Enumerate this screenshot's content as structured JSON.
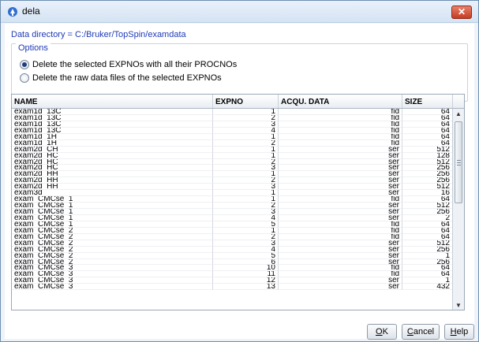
{
  "window": {
    "title": "dela",
    "close_glyph": "✕",
    "app_icon": "topspin-app-icon"
  },
  "data_directory": "Data directory = C:/Bruker/TopSpin/examdata",
  "options": {
    "legend": "Options",
    "items": [
      {
        "label": "Delete the selected EXPNOs with all their PROCNOs",
        "selected": true
      },
      {
        "label": "Delete the raw data files of the selected EXPNOs",
        "selected": false
      }
    ]
  },
  "table": {
    "columns": [
      "NAME",
      "EXPNO",
      "ACQU. DATA",
      "SIZE"
    ],
    "rows": [
      [
        "exam1d_13C",
        "1",
        "fid",
        "64"
      ],
      [
        "exam1d_13C",
        "2",
        "fid",
        "64"
      ],
      [
        "exam1d_13C",
        "3",
        "fid",
        "64"
      ],
      [
        "exam1d_13C",
        "4",
        "fid",
        "64"
      ],
      [
        "exam1d_1H",
        "1",
        "fid",
        "64"
      ],
      [
        "exam1d_1H",
        "2",
        "fid",
        "64"
      ],
      [
        "exam2d_CH",
        "1",
        "ser",
        "512"
      ],
      [
        "exam2d_HC",
        "1",
        "ser",
        "128"
      ],
      [
        "exam2d_HC",
        "2",
        "ser",
        "512"
      ],
      [
        "exam2d_HC",
        "3",
        "ser",
        "256"
      ],
      [
        "exam2d_HH",
        "1",
        "ser",
        "256"
      ],
      [
        "exam2d_HH",
        "2",
        "ser",
        "256"
      ],
      [
        "exam2d_HH",
        "3",
        "ser",
        "512"
      ],
      [
        "exam3d",
        "1",
        "ser",
        "16"
      ],
      [
        "exam_CMCse_1",
        "1",
        "fid",
        "64"
      ],
      [
        "exam_CMCse_1",
        "2",
        "ser",
        "512"
      ],
      [
        "exam_CMCse_1",
        "3",
        "ser",
        "256"
      ],
      [
        "exam_CMCse_1",
        "4",
        "ser",
        "2"
      ],
      [
        "exam_CMCse_1",
        "5",
        "fid",
        "64"
      ],
      [
        "exam_CMCse_2",
        "1",
        "fid",
        "64"
      ],
      [
        "exam_CMCse_2",
        "2",
        "fid",
        "64"
      ],
      [
        "exam_CMCse_2",
        "3",
        "ser",
        "512"
      ],
      [
        "exam_CMCse_2",
        "4",
        "ser",
        "256"
      ],
      [
        "exam_CMCse_2",
        "5",
        "ser",
        "1"
      ],
      [
        "exam_CMCse_2",
        "6",
        "ser",
        "256"
      ],
      [
        "exam_CMCse_3",
        "10",
        "fid",
        "64"
      ],
      [
        "exam_CMCse_3",
        "11",
        "fid",
        "64"
      ],
      [
        "exam_CMCse_3",
        "12",
        "ser",
        "1"
      ],
      [
        "exam_CMCse_3",
        "13",
        "ser",
        "432"
      ]
    ]
  },
  "scrollbar": {
    "up_glyph": "▲",
    "down_glyph": "▼"
  },
  "buttons": {
    "ok": {
      "mnemonic": "O",
      "rest": "K"
    },
    "cancel": {
      "mnemonic": "C",
      "rest": "ancel"
    },
    "help": {
      "mnemonic": "H",
      "rest": "elp"
    }
  }
}
